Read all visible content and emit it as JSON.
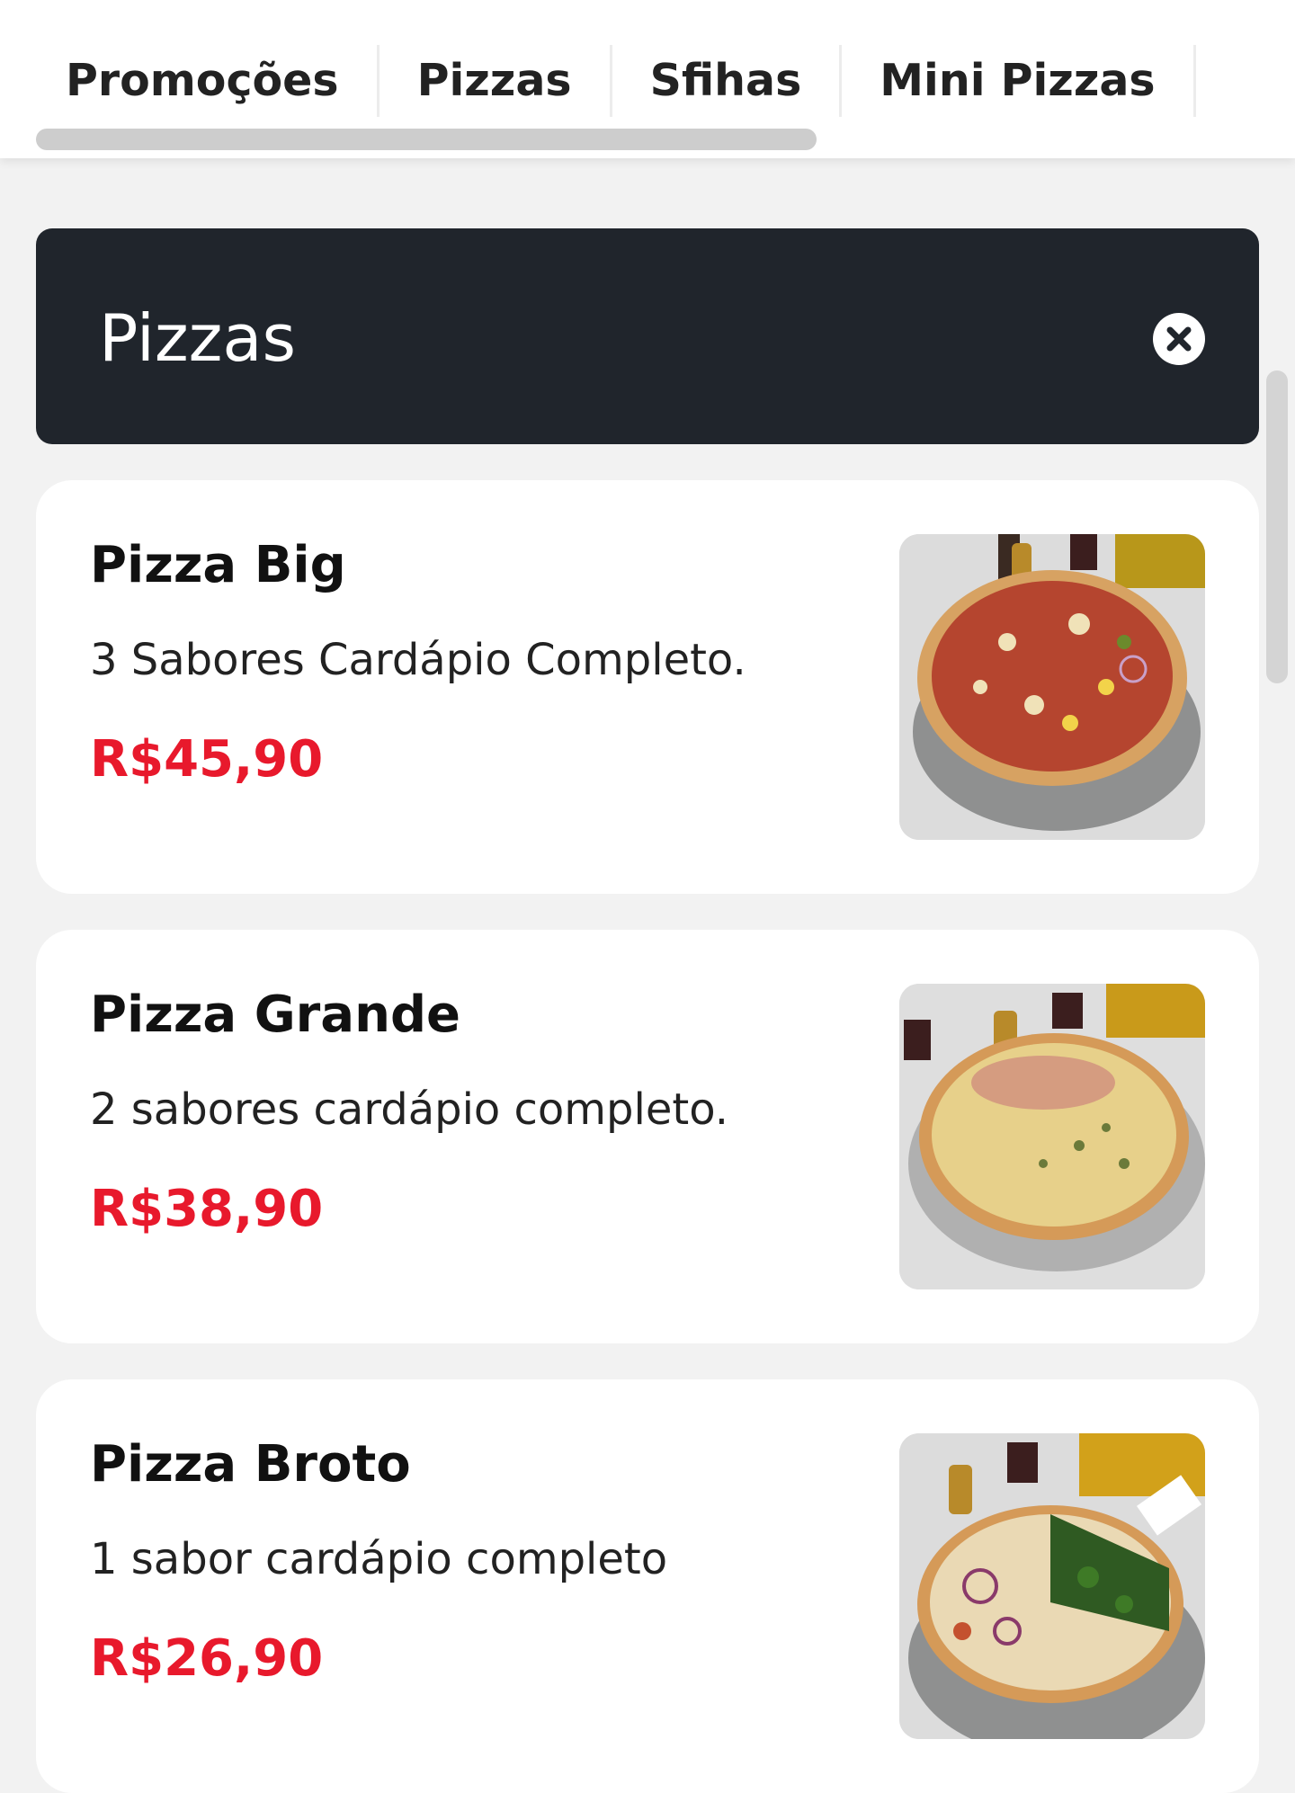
{
  "tabs": [
    {
      "label": "Promoções"
    },
    {
      "label": "Pizzas"
    },
    {
      "label": "Sfihas"
    },
    {
      "label": "Mini Pizzas"
    }
  ],
  "section": {
    "title": "Pizzas",
    "close_icon": "close-circle-icon"
  },
  "products": [
    {
      "name": "Pizza Big",
      "description": "3 Sabores Cardápio Completo.",
      "price": "R$45,90"
    },
    {
      "name": "Pizza Grande",
      "description": "2 sabores cardápio completo.",
      "price": "R$38,90"
    },
    {
      "name": "Pizza Broto",
      "description": "1 sabor cardápio completo",
      "price": "R$26,90"
    }
  ],
  "colors": {
    "price": "#e8192c",
    "header_bg": "#20252c",
    "page_bg": "#f2f2f2"
  }
}
